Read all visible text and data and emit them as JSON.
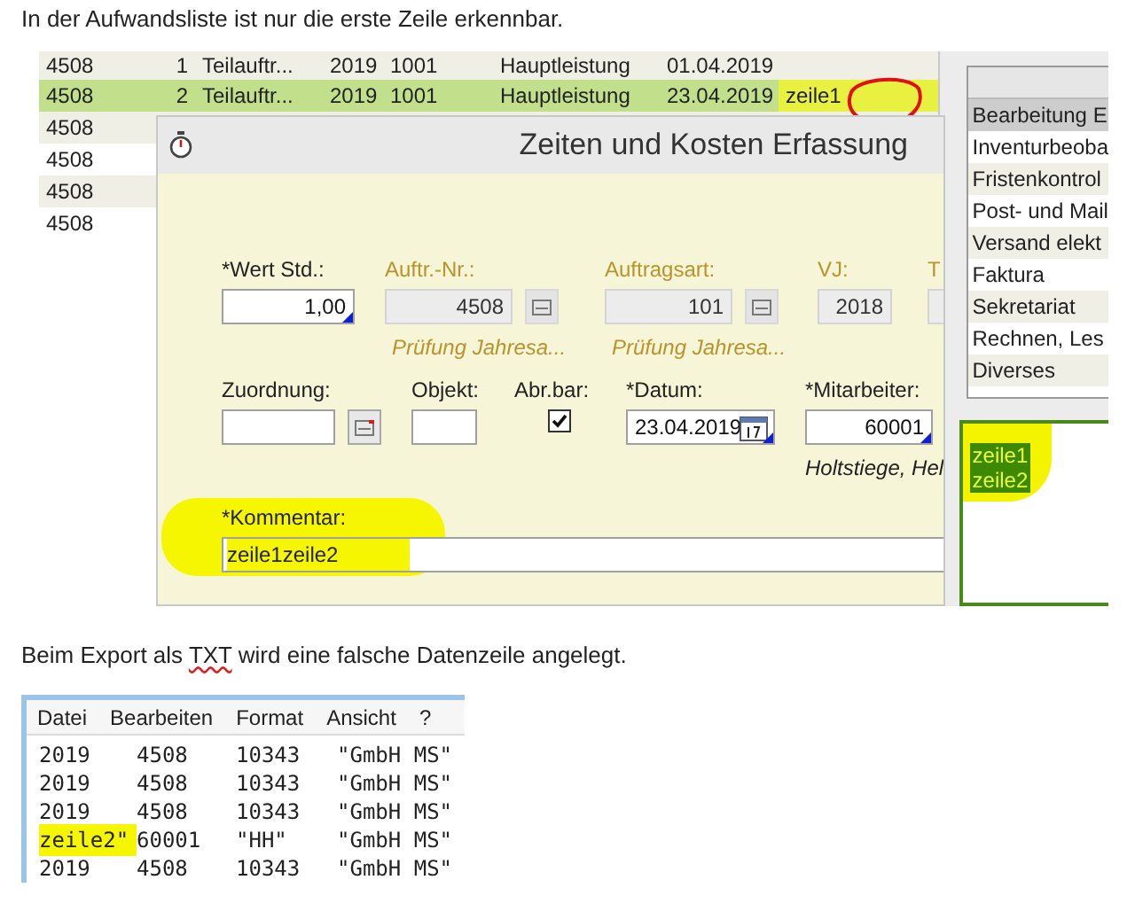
{
  "intro": "In der Aufwandsliste ist nur die erste Zeile erkennbar.",
  "list": {
    "rows": [
      {
        "cells": [
          "4508",
          "1",
          "Teilauftr...",
          "2019",
          "1001",
          "Hauptleistung",
          "01.04.2019"
        ],
        "selected": false
      },
      {
        "cells": [
          "4508",
          "2",
          "Teilauftr...",
          "2019",
          "1001",
          "Hauptleistung",
          "23.04.2019",
          "zeile1"
        ],
        "selected": true
      },
      {
        "cells": [
          "4508"
        ],
        "selected": false
      },
      {
        "cells": [
          "4508"
        ],
        "selected": false
      },
      {
        "cells": [
          "4508"
        ],
        "selected": false
      },
      {
        "cells": [
          "4508"
        ],
        "selected": false
      }
    ]
  },
  "categories": [
    {
      "label": "Bearbeitung E",
      "selected": true
    },
    {
      "label": "Inventurbeoba",
      "selected": false
    },
    {
      "label": "Fristenkontrol",
      "selected": false
    },
    {
      "label": "Post- und Mail",
      "selected": false
    },
    {
      "label": "Versand elekt",
      "selected": false
    },
    {
      "label": "Faktura",
      "selected": false
    },
    {
      "label": "Sekretariat",
      "selected": false
    },
    {
      "label": "Rechnen, Les",
      "selected": false
    },
    {
      "label": "Diverses",
      "selected": false
    }
  ],
  "preview": {
    "lines": [
      "zeile1",
      "zeile2"
    ]
  },
  "dialog": {
    "title": "Zeiten und Kosten Erfassung",
    "row1": [
      {
        "kind": "text",
        "label": "*Wert Std.:",
        "value": "1,00",
        "disabled": false
      },
      {
        "kind": "lookup",
        "label": "Auftr.-Nr.:",
        "value": "4508",
        "disabled": true,
        "hint": "Prüfung Jahresa..."
      },
      {
        "kind": "lookup",
        "label": "Auftragsart:",
        "value": "101",
        "disabled": true,
        "hint": "Prüfung Jahresa..."
      },
      {
        "kind": "text",
        "label": "VJ:",
        "value": "2018",
        "disabled": true
      },
      {
        "kind": "text",
        "label": "T",
        "disabled": true
      }
    ],
    "row2": [
      {
        "kind": "lookup",
        "label": "Zuordnung:",
        "disabled": false
      },
      {
        "kind": "text",
        "label": "Objekt:",
        "disabled": false
      },
      {
        "kind": "checkbox",
        "label": "Abr.bar:",
        "checked": true
      },
      {
        "kind": "date",
        "label": "*Datum:",
        "value": "23.04.2019",
        "disabled": false
      },
      {
        "kind": "text",
        "label": "*Mitarbeiter:",
        "value": "60001",
        "disabled": false,
        "hint": "Holtstiege, Hel"
      }
    ],
    "comment": {
      "label": "*Kommentar:",
      "value": "zeile1zeile2"
    }
  },
  "outro": {
    "before": "Beim Export als",
    "word": "TXT",
    "after": "wird eine falsche Datenzeile angelegt."
  },
  "notepad": {
    "menu": [
      "Datei",
      "Bearbeiten",
      "Format",
      "Ansicht",
      "?"
    ],
    "lines": [
      {
        "cells": [
          "2019",
          "4508",
          "10343",
          "\"GmbH MS\""
        ],
        "highlighted": false
      },
      {
        "cells": [
          "2019",
          "4508",
          "10343",
          "\"GmbH MS\""
        ],
        "highlighted": false
      },
      {
        "cells": [
          "2019",
          "4508",
          "10343",
          "\"GmbH MS\""
        ],
        "highlighted": false
      },
      {
        "cells": [
          "zeile2\"",
          "60001",
          "\"HH\"",
          "\"GmbH MS\""
        ],
        "highlighted": true
      },
      {
        "cells": [
          "2019",
          "4508",
          "10343",
          "\"GmbH MS\""
        ],
        "highlighted": false
      }
    ]
  }
}
